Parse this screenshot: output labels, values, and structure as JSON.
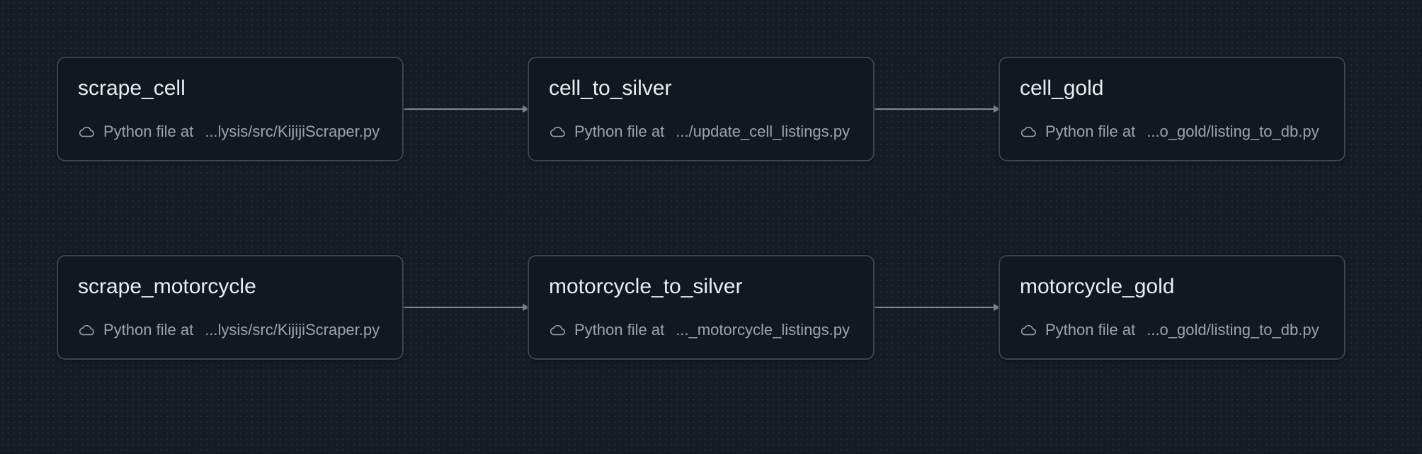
{
  "colors": {
    "background": "#171c24",
    "node_bg": "#121820",
    "node_border": "#3a4452",
    "edge": "#7c8896",
    "title": "#e9eef4",
    "subtitle": "#9aa4b0"
  },
  "tasks": [
    {
      "name": "scrape_cell",
      "type_label": "Python file at",
      "path": "...lysis/src/KijijiScraper.py",
      "icon": "cloud-icon"
    },
    {
      "name": "cell_to_silver",
      "type_label": "Python file at",
      "path": ".../update_cell_listings.py",
      "icon": "cloud-icon"
    },
    {
      "name": "cell_gold",
      "type_label": "Python file at",
      "path": "...o_gold/listing_to_db.py",
      "icon": "cloud-icon"
    },
    {
      "name": "scrape_motorcycle",
      "type_label": "Python file at",
      "path": "...lysis/src/KijijiScraper.py",
      "icon": "cloud-icon"
    },
    {
      "name": "motorcycle_to_silver",
      "type_label": "Python file at",
      "path": "..._motorcycle_listings.py",
      "icon": "cloud-icon"
    },
    {
      "name": "motorcycle_gold",
      "type_label": "Python file at",
      "path": "...o_gold/listing_to_db.py",
      "icon": "cloud-icon"
    }
  ],
  "dependencies": [
    {
      "from": "scrape_cell",
      "to": "cell_to_silver"
    },
    {
      "from": "cell_to_silver",
      "to": "cell_gold"
    },
    {
      "from": "scrape_motorcycle",
      "to": "motorcycle_to_silver"
    },
    {
      "from": "motorcycle_to_silver",
      "to": "motorcycle_gold"
    }
  ]
}
